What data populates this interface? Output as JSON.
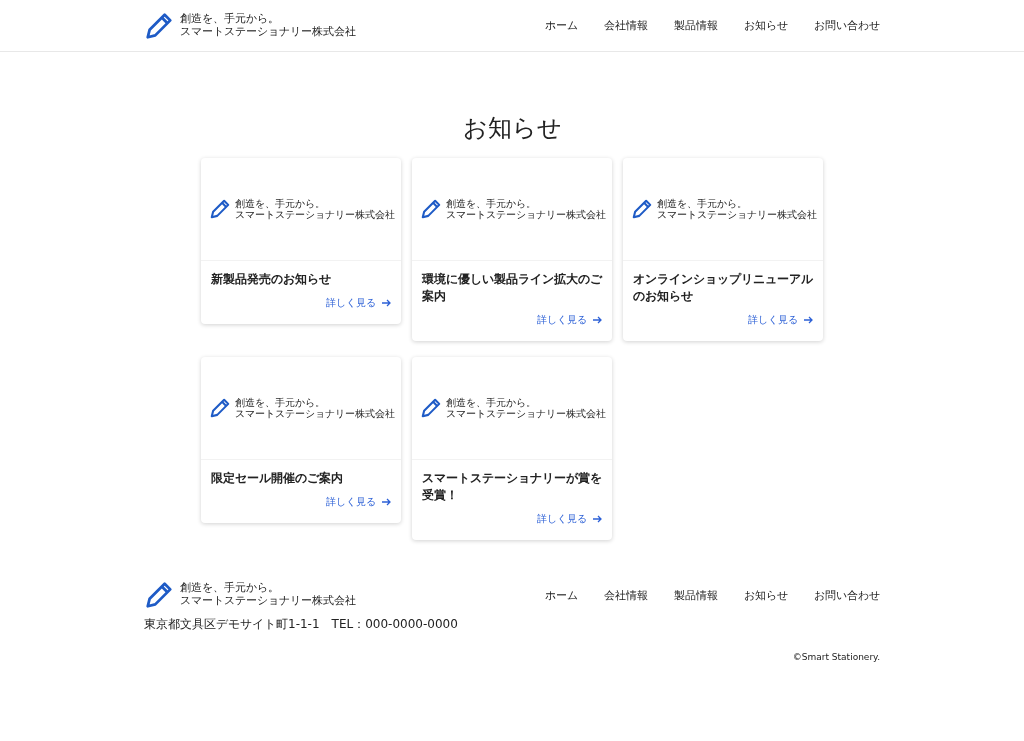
{
  "header": {
    "logo": {
      "tagline": "創造を、手元から。",
      "company": "スマートステーショナリー株式会社"
    },
    "nav": [
      "ホーム",
      "会社情報",
      "製品情報",
      "お知らせ",
      "お問い合わせ"
    ]
  },
  "page_title": "お知らせ",
  "cards": [
    {
      "thumbnail": {
        "tagline": "創造を、手元から。",
        "company": "スマートステーショナリー株式会社"
      },
      "title": "新製品発売のお知らせ",
      "link": "詳しく見る"
    },
    {
      "thumbnail": {
        "tagline": "創造を、手元から。",
        "company": "スマートステーショナリー株式会社"
      },
      "title": "環境に優しい製品ライン拡大のご案内",
      "link": "詳しく見る"
    },
    {
      "thumbnail": {
        "tagline": "創造を、手元から。",
        "company": "スマートステーショナリー株式会社"
      },
      "title": "オンラインショップリニューアルのお知らせ",
      "link": "詳しく見る"
    },
    {
      "thumbnail": {
        "tagline": "創造を、手元から。",
        "company": "スマートステーショナリー株式会社"
      },
      "title": "限定セール開催のご案内",
      "link": "詳しく見る"
    },
    {
      "thumbnail": {
        "tagline": "創造を、手元から。",
        "company": "スマートステーショナリー株式会社"
      },
      "title": "スマートステーショナリーが賞を受賞！",
      "link": "詳しく見る"
    }
  ],
  "footer": {
    "logo": {
      "tagline": "創造を、手元から。",
      "company": "スマートステーショナリー株式会社"
    },
    "address": "東京都文具区デモサイト町1-1-1　TEL：000-0000-0000",
    "nav": [
      "ホーム",
      "会社情報",
      "製品情報",
      "お知らせ",
      "お問い合わせ"
    ],
    "copyright": "©Smart Stationery."
  }
}
